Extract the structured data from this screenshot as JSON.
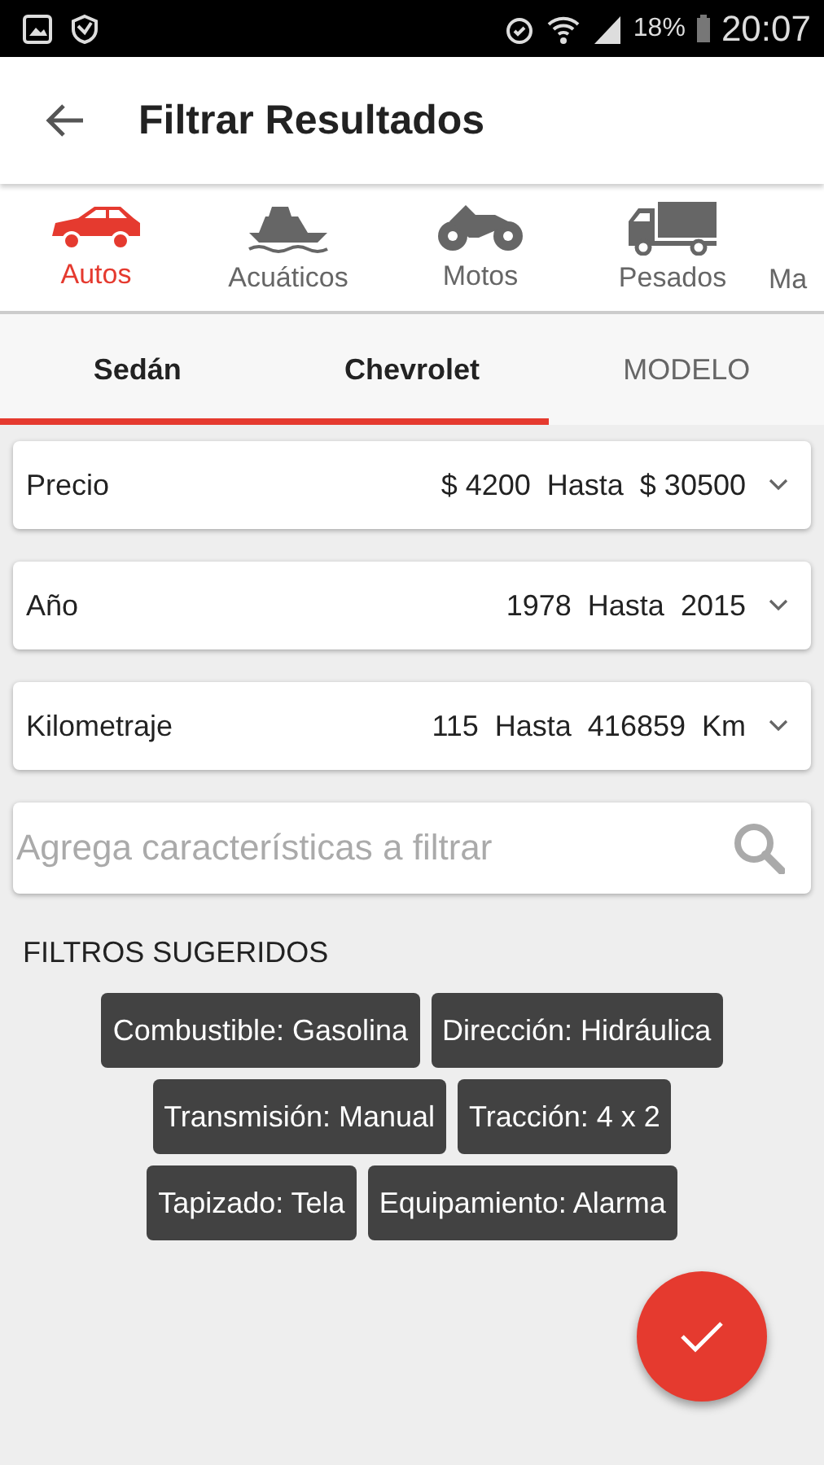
{
  "status_bar": {
    "battery": "18%",
    "time": "20:07"
  },
  "toolbar": {
    "title": "Filtrar Resultados"
  },
  "categories": [
    {
      "label": "Autos",
      "kind": "car",
      "selected": true
    },
    {
      "label": "Acuáticos",
      "kind": "boat",
      "selected": false
    },
    {
      "label": "Motos",
      "kind": "motorcycle",
      "selected": false
    },
    {
      "label": "Pesados",
      "kind": "truck",
      "selected": false
    },
    {
      "label": "Ma",
      "kind": "cut",
      "selected": false
    }
  ],
  "tabs": [
    {
      "label": "Sedán",
      "selected": true
    },
    {
      "label": "Chevrolet",
      "selected": true
    },
    {
      "label": "MODELO",
      "selected": false
    }
  ],
  "filters": [
    {
      "label": "Precio",
      "value": "$ 4200  Hasta  $ 30500"
    },
    {
      "label": "Año",
      "value": "1978  Hasta  2015"
    },
    {
      "label": "Kilometraje",
      "value": "115  Hasta  416859  Km"
    }
  ],
  "search": {
    "placeholder": "Agrega características a filtrar"
  },
  "suggested": {
    "heading": "FILTROS SUGERIDOS",
    "rows": [
      [
        "Combustible: Gasolina",
        "Dirección: Hidráulica"
      ],
      [
        "Transmisión: Manual",
        "Tracción: 4 x 2"
      ],
      [
        "Tapizado: Tela",
        "Equipamiento: Alarma"
      ]
    ]
  }
}
